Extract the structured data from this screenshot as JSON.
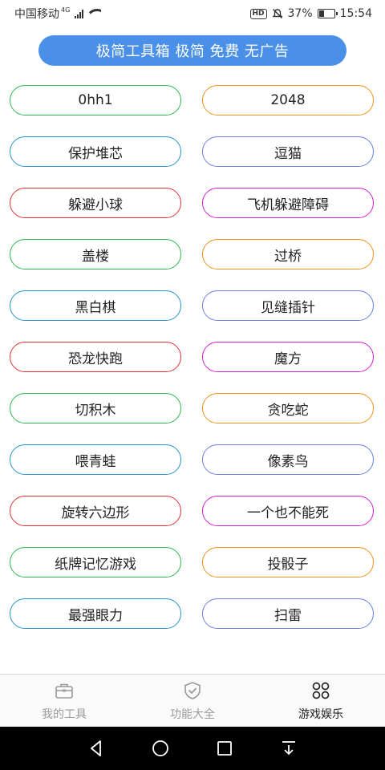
{
  "status": {
    "carrier": "中国移动",
    "network": "4G",
    "hd": "HD",
    "battery_pct": "37%",
    "battery_level": 0.37,
    "time": "15:54"
  },
  "banner": {
    "text": "极简工具箱  极简 免费 无广告"
  },
  "games": [
    {
      "label": "0hh1",
      "color": "#2db84d"
    },
    {
      "label": "2048",
      "color": "#f0921e"
    },
    {
      "label": "保护堆芯",
      "color": "#2596c8"
    },
    {
      "label": "逗猫",
      "color": "#6a7fe0"
    },
    {
      "label": "躲避小球",
      "color": "#e0303a"
    },
    {
      "label": "飞机躲避障碍",
      "color": "#d21fd6"
    },
    {
      "label": "盖楼",
      "color": "#2db84d"
    },
    {
      "label": "过桥",
      "color": "#f0921e"
    },
    {
      "label": "黑白棋",
      "color": "#2596c8"
    },
    {
      "label": "见缝插针",
      "color": "#6a7fe0"
    },
    {
      "label": "恐龙快跑",
      "color": "#e0303a"
    },
    {
      "label": "魔方",
      "color": "#d21fd6"
    },
    {
      "label": "切积木",
      "color": "#2db84d"
    },
    {
      "label": "贪吃蛇",
      "color": "#f0921e"
    },
    {
      "label": "喂青蛙",
      "color": "#2596c8"
    },
    {
      "label": "像素鸟",
      "color": "#6a7fe0"
    },
    {
      "label": "旋转六边形",
      "color": "#e0303a"
    },
    {
      "label": "一个也不能死",
      "color": "#d21fd6"
    },
    {
      "label": "纸牌记忆游戏",
      "color": "#2db84d"
    },
    {
      "label": "投骰子",
      "color": "#f0921e"
    },
    {
      "label": "最强眼力",
      "color": "#2596c8"
    },
    {
      "label": "扫雷",
      "color": "#6a7fe0"
    }
  ],
  "nav": {
    "tools": {
      "label": "我的工具",
      "icon": "briefcase-icon"
    },
    "features": {
      "label": "功能大全",
      "icon": "shield-check-icon"
    },
    "games": {
      "label": "游戏娱乐",
      "icon": "grid-icon",
      "active": true
    }
  },
  "system_nav": [
    "back-icon",
    "home-icon",
    "recents-icon",
    "notification-pull-icon"
  ]
}
